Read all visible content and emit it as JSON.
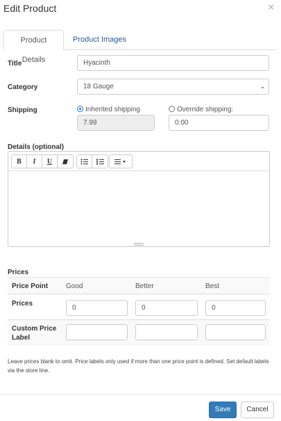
{
  "header": {
    "title": "Edit Product",
    "close_glyph": "×"
  },
  "tabs": [
    {
      "label": "Product Details",
      "active": true
    },
    {
      "label": "Product Images",
      "active": false
    }
  ],
  "form": {
    "title_label": "Title",
    "title_value": "Hyacinth",
    "category_label": "Category",
    "category_value": "18 Gauge",
    "shipping_label": "Shipping",
    "inherited_label": "Inherited shipping",
    "inherited_value": "7.99",
    "override_label": "Override shipping:",
    "override_value": "0.00",
    "shipping_mode": "inherited",
    "details_label": "Details (optional)"
  },
  "editor_toolbar": {
    "groups": [
      [
        {
          "icon": "bold-icon",
          "glyph": "B"
        },
        {
          "icon": "italic-icon",
          "glyph": "I"
        },
        {
          "icon": "underline-icon",
          "glyph": "U"
        },
        {
          "icon": "eraser-icon",
          "glyph": "⌫"
        }
      ],
      [
        {
          "icon": "bulleted-list-icon",
          "glyph": "☰"
        },
        {
          "icon": "numbered-list-icon",
          "glyph": "≡"
        }
      ],
      [
        {
          "icon": "align-dropdown-icon",
          "glyph": "≡▾"
        }
      ]
    ]
  },
  "prices": {
    "section_label": "Prices",
    "columns_header": "Price Point",
    "columns": [
      "Good",
      "Better",
      "Best"
    ],
    "prices_row_label": "Prices",
    "price_values": [
      "0",
      "0",
      "0"
    ],
    "custom_label_row_label": "Custom Price Label",
    "custom_label_values": [
      "",
      "",
      ""
    ]
  },
  "help_text": "Leave prices blank to omit. Price labels only used if more than one price point is defined. Set default labels via the store line.",
  "footer": {
    "save_label": "Save",
    "cancel_label": "Cancel"
  },
  "colors": {
    "primary": "#337ab7",
    "link": "#2a5a96",
    "radio_accent": "#1a73e8"
  }
}
